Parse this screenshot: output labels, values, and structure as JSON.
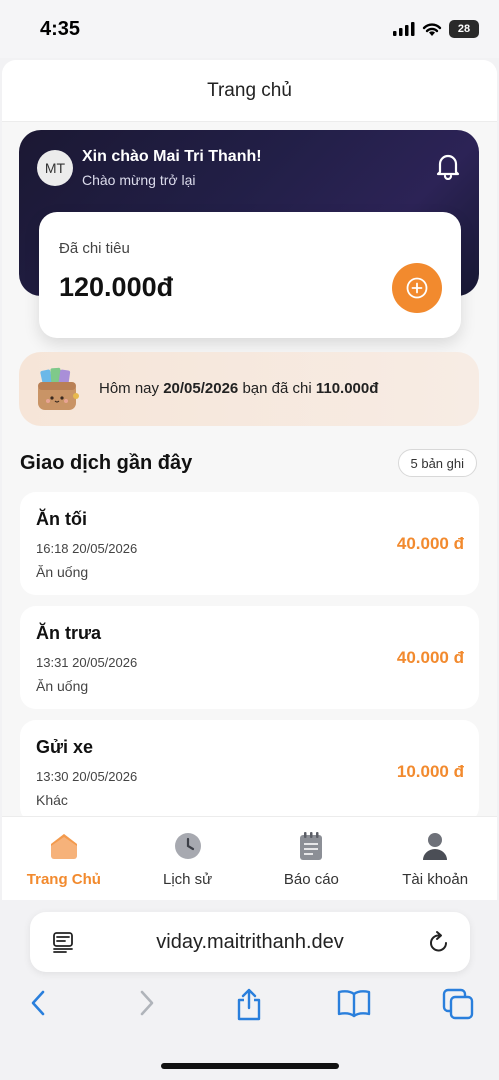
{
  "status_bar": {
    "time": "4:35",
    "battery": "28"
  },
  "app": {
    "title": "Trang chủ",
    "user": {
      "initials": "MT",
      "greeting": "Xin chào Mai Tri Thanh!",
      "subtitle": "Chào mừng trở lại"
    },
    "spend_card": {
      "label": "Đã chi tiêu",
      "value": "120.000đ"
    },
    "today_banner": {
      "prefix": "Hôm nay ",
      "date": "20/05/2026",
      "middle": " bạn đã chi ",
      "amount": "110.000đ"
    },
    "recent": {
      "title": "Giao dịch gần đây",
      "count_label": "5 bản ghi",
      "transactions": [
        {
          "name": "Ăn tối",
          "time": "16:18 20/05/2026",
          "category": "Ăn uống",
          "amount": "40.000 đ"
        },
        {
          "name": "Ăn trưa",
          "time": "13:31 20/05/2026",
          "category": "Ăn uống",
          "amount": "40.000 đ"
        },
        {
          "name": "Gửi xe",
          "time": "13:30 20/05/2026",
          "category": "Khác",
          "amount": "10.000 đ"
        }
      ]
    },
    "nav": {
      "items": [
        {
          "label": "Trang Chủ",
          "icon": "home-icon",
          "active": true
        },
        {
          "label": "Lịch sử",
          "icon": "clock-icon",
          "active": false
        },
        {
          "label": "Báo cáo",
          "icon": "report-icon",
          "active": false
        },
        {
          "label": "Tài khoản",
          "icon": "user-icon",
          "active": false
        }
      ]
    },
    "colors": {
      "accent": "#f28a2e",
      "hero_bg": "#1f1c40",
      "banner_bg": "#f6e5d8"
    }
  },
  "browser": {
    "url": "viday.maitrithanh.dev"
  }
}
